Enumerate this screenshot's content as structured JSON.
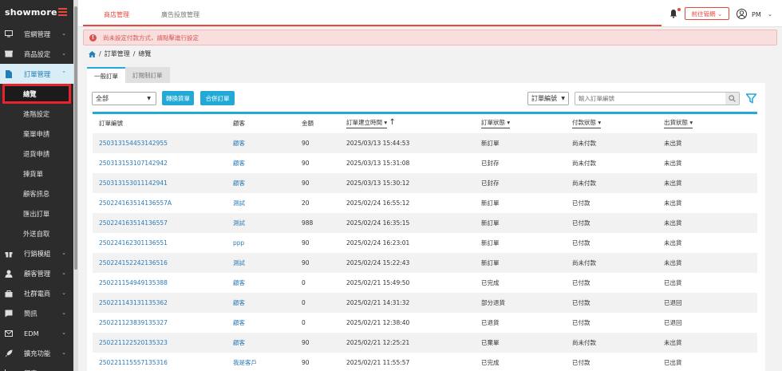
{
  "brand": {
    "logo_text": "showmore"
  },
  "sidebar": {
    "items": [
      {
        "label": "官網管理",
        "icon": "monitor-icon"
      },
      {
        "label": "商品設定",
        "icon": "box-icon"
      },
      {
        "label": "訂單管理",
        "icon": "document-icon",
        "active": true
      },
      {
        "label": "行銷模組",
        "icon": "gift-icon"
      },
      {
        "label": "顧客管理",
        "icon": "person-icon"
      },
      {
        "label": "社群電商",
        "icon": "bag-icon"
      },
      {
        "label": "簡訊",
        "icon": "message-icon"
      },
      {
        "label": "EDM",
        "icon": "mail-icon"
      },
      {
        "label": "擴充功能",
        "icon": "rocket-icon"
      },
      {
        "label": "報表",
        "icon": "chart-icon"
      }
    ],
    "sub_items": [
      "總覽",
      "進階設定",
      "棄單申請",
      "退貨申請",
      "揀貨單",
      "顧客訊息",
      "匯出訂單",
      "外送自取"
    ]
  },
  "header": {
    "tabs": [
      "商店管理",
      "廣告投放管理"
    ],
    "store_button": "前往管網",
    "user_name": "PM"
  },
  "alert": {
    "message": "尚未設定付款方式，請點擊進行設定"
  },
  "breadcrumb": [
    "訂單管理",
    "總覽"
  ],
  "panel_tabs": [
    "一般訂單",
    "訂閱制訂單"
  ],
  "toolbar": {
    "status_filter": "全部",
    "transfer_button": "轉換貨單",
    "merge_button": "合併訂單",
    "search_field_select": "訂單編號",
    "search_placeholder": "輸入訂單編號"
  },
  "table": {
    "headers": [
      "訂單編號",
      "顧客",
      "金額",
      "訂單建立時間",
      "訂單狀態",
      "付款狀態",
      "出貨狀態"
    ],
    "rows": [
      [
        "250313154453142955",
        "顧客",
        "90",
        "2025/03/13 15:44:53",
        "新訂單",
        "尚未付款",
        "未出貨"
      ],
      [
        "250313153107142942",
        "顧客",
        "90",
        "2025/03/13 15:31:08",
        "已封存",
        "尚未付款",
        "未出貨"
      ],
      [
        "250313153011142941",
        "顧客",
        "90",
        "2025/03/13 15:30:12",
        "已封存",
        "尚未付款",
        "未出貨"
      ],
      [
        "250224163514136557A",
        "測試",
        "20",
        "2025/02/24 16:55:12",
        "新訂單",
        "已付款",
        "未出貨"
      ],
      [
        "250224163514136557",
        "測試",
        "988",
        "2025/02/24 16:35:15",
        "新訂單",
        "已付款",
        "未出貨"
      ],
      [
        "250224162301136551",
        "ppp",
        "90",
        "2025/02/24 16:23:01",
        "新訂單",
        "已付款",
        "未出貨"
      ],
      [
        "250224152242136516",
        "測試",
        "90",
        "2025/02/24 15:22:43",
        "新訂單",
        "尚未付款",
        "未出貨"
      ],
      [
        "250221154949135388",
        "顧客",
        "0",
        "2025/02/21 15:49:50",
        "已完成",
        "已付款",
        "已出貨"
      ],
      [
        "250221143131135362",
        "顧客",
        "0",
        "2025/02/21 14:31:32",
        "部分退貨",
        "已付款",
        "已退回"
      ],
      [
        "250221123839135327",
        "顧客",
        "0",
        "2025/02/21 12:38:40",
        "已退貨",
        "已付款",
        "已退回"
      ],
      [
        "250221122520135323",
        "顧客",
        "90",
        "2025/02/21 12:25:21",
        "已棄單",
        "尚未付款",
        "未出貨"
      ],
      [
        "250221115557135316",
        "我是客戶",
        "90",
        "2025/02/21 11:55:57",
        "已完成",
        "已付款",
        "已出貨"
      ]
    ]
  },
  "colors": {
    "accent": "#e8473c",
    "primary": "#22a9d6",
    "link": "#2a7ab8",
    "sidebar_bg": "#2c2c2c"
  }
}
